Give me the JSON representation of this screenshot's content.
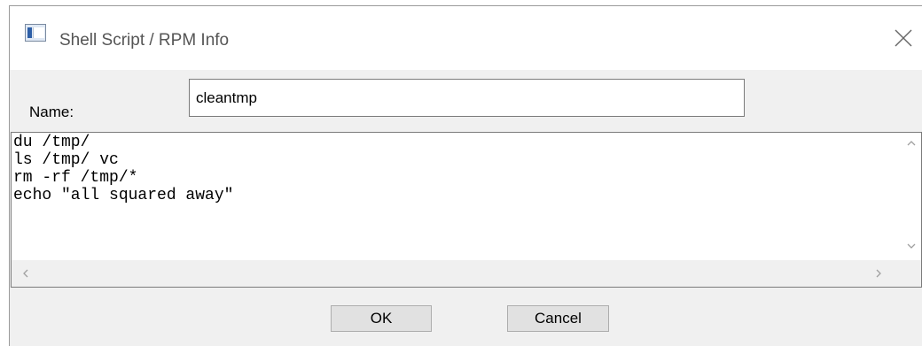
{
  "window": {
    "title": "Shell Script / RPM Info",
    "icon": "app-window-icon",
    "close_icon": "close-icon"
  },
  "form": {
    "name_label": "Name:",
    "name_value": "cleantmp"
  },
  "script": {
    "lines": [
      "du /tmp/",
      "ls /tmp/ vc",
      "rm -rf /tmp/*",
      "echo \"all squared away\""
    ]
  },
  "buttons": {
    "ok_label": "OK",
    "cancel_label": "Cancel"
  }
}
